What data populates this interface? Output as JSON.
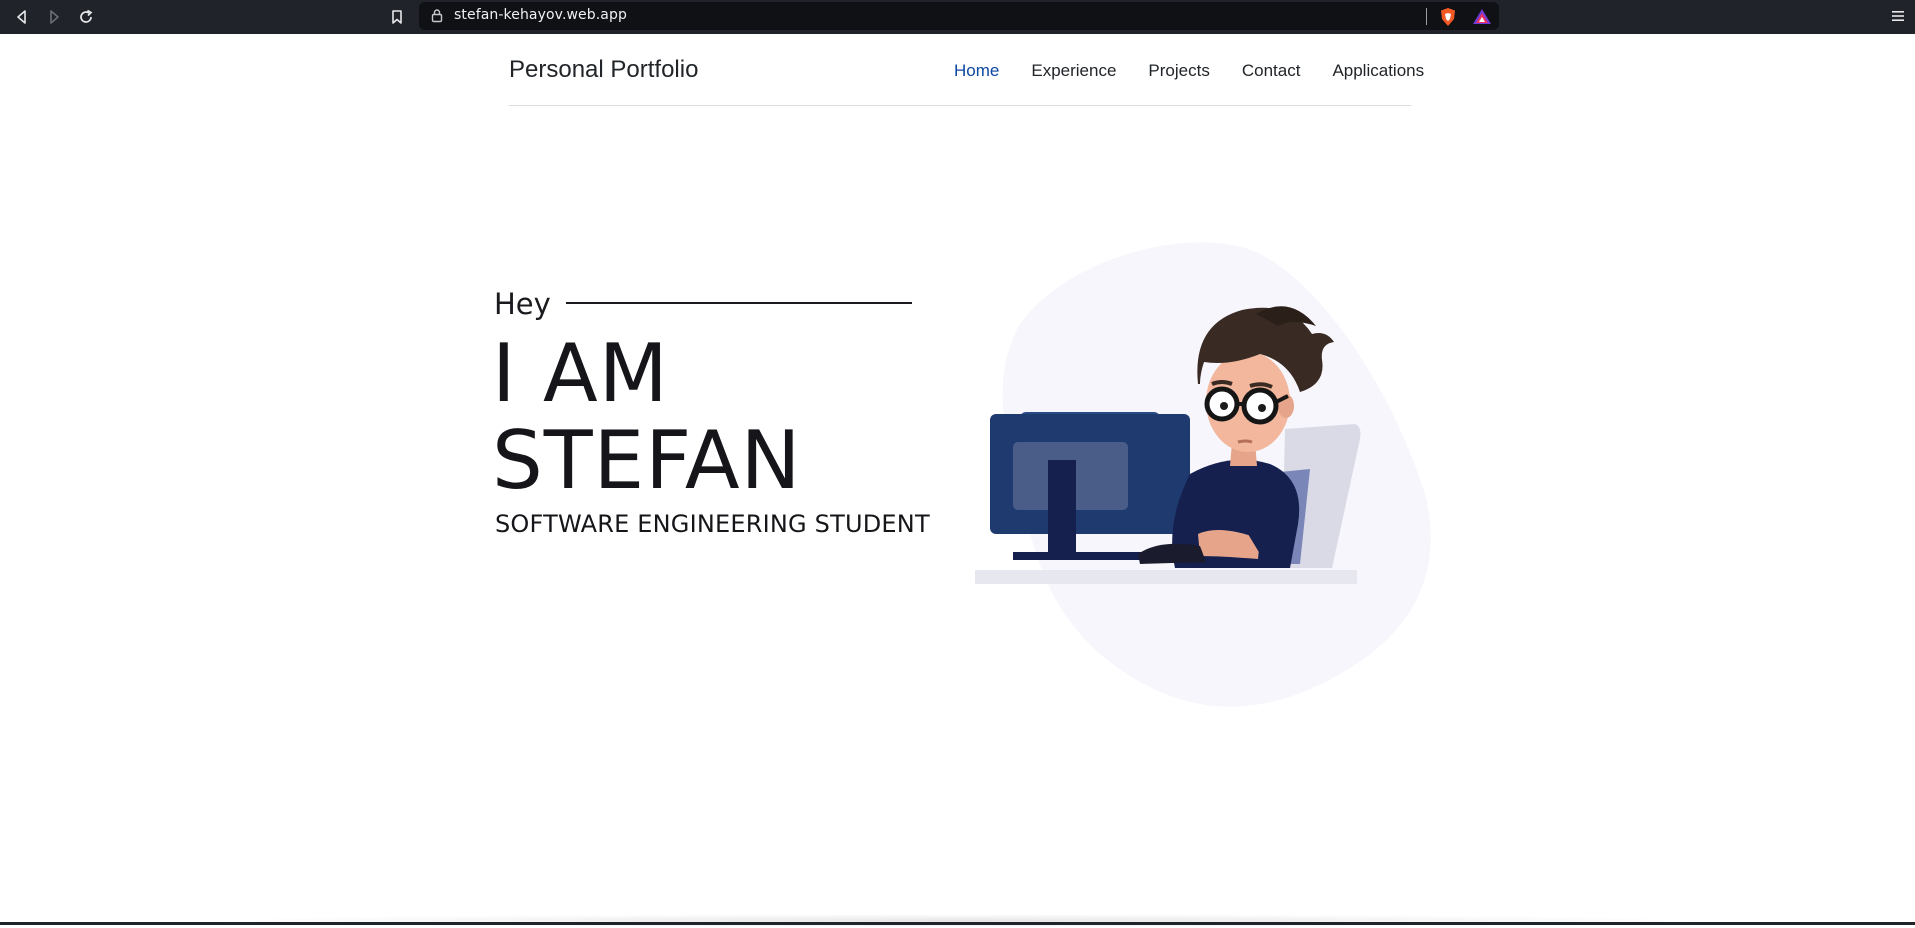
{
  "browser": {
    "url": "stefan-kehayov.web.app",
    "icons": [
      "back-icon",
      "forward-icon",
      "reload-icon",
      "bookmark-icon",
      "lock-icon",
      "brave-shield-icon",
      "brave-rewards-icon",
      "menu-icon"
    ]
  },
  "header": {
    "brand": "Personal Portfolio",
    "nav": [
      "Home",
      "Experience",
      "Projects",
      "Contact",
      "Applications"
    ],
    "active": "Home",
    "active_color": "#0d47a1"
  },
  "hero": {
    "greeting": "Hey",
    "line1": "I AM",
    "line2": "STEFAN",
    "subtitle": "SOFTWARE ENGINEERING STUDENT"
  },
  "colors": {
    "chrome_bg": "#202329",
    "url_bg": "#0f1115",
    "text": "#1b1b1f",
    "blob": "#f6f6fc",
    "monitor": "#1e3a6e",
    "shirt": "#16204f"
  }
}
